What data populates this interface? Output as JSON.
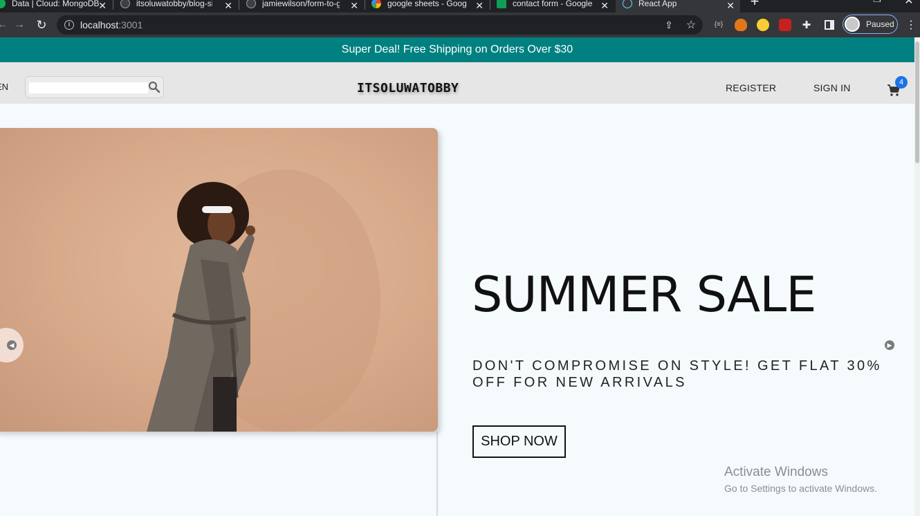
{
  "browser": {
    "tabs": [
      {
        "title": "Data | Cloud: MongoDB",
        "favicon_color": "#13aa52"
      },
      {
        "title": "itsoluwatobby/blog-site",
        "favicon_color": "#3c4043"
      },
      {
        "title": "jamiewilson/form-to-g",
        "favicon_color": "#3c4043"
      },
      {
        "title": "google sheets - Google",
        "favicon_color": "#ffffff"
      },
      {
        "title": "contact form - Google",
        "favicon_color": "#0f9d58"
      },
      {
        "title": "React App",
        "favicon_color": "#61dafb"
      }
    ],
    "url_host": "localhost",
    "url_port": ":3001",
    "profile_status": "Paused"
  },
  "page": {
    "announcement": "Super Deal! Free Shipping on Orders Over $30",
    "navbar": {
      "language": "EN",
      "search_value": "",
      "logo": "ITSOLUWATOBBY",
      "register_label": "REGISTER",
      "signin_label": "SIGN IN",
      "cart_count": "4"
    },
    "slide": {
      "title": "SUMMER SALE",
      "description": "DON'T COMPROMISE ON STYLE! GET FLAT 30% OFF FOR NEW ARRIVALS",
      "button_label": "SHOP NOW",
      "background_color": "#f5fbfd",
      "image_color": "#d9ab8c"
    }
  },
  "os_watermark": {
    "line1": "Activate Windows",
    "line2": "Go to Settings to activate Windows."
  },
  "colors": {
    "announcement_bg": "#008080",
    "navbar_bg": "#e6e6e6",
    "cart_badge": "#1a73e8"
  }
}
